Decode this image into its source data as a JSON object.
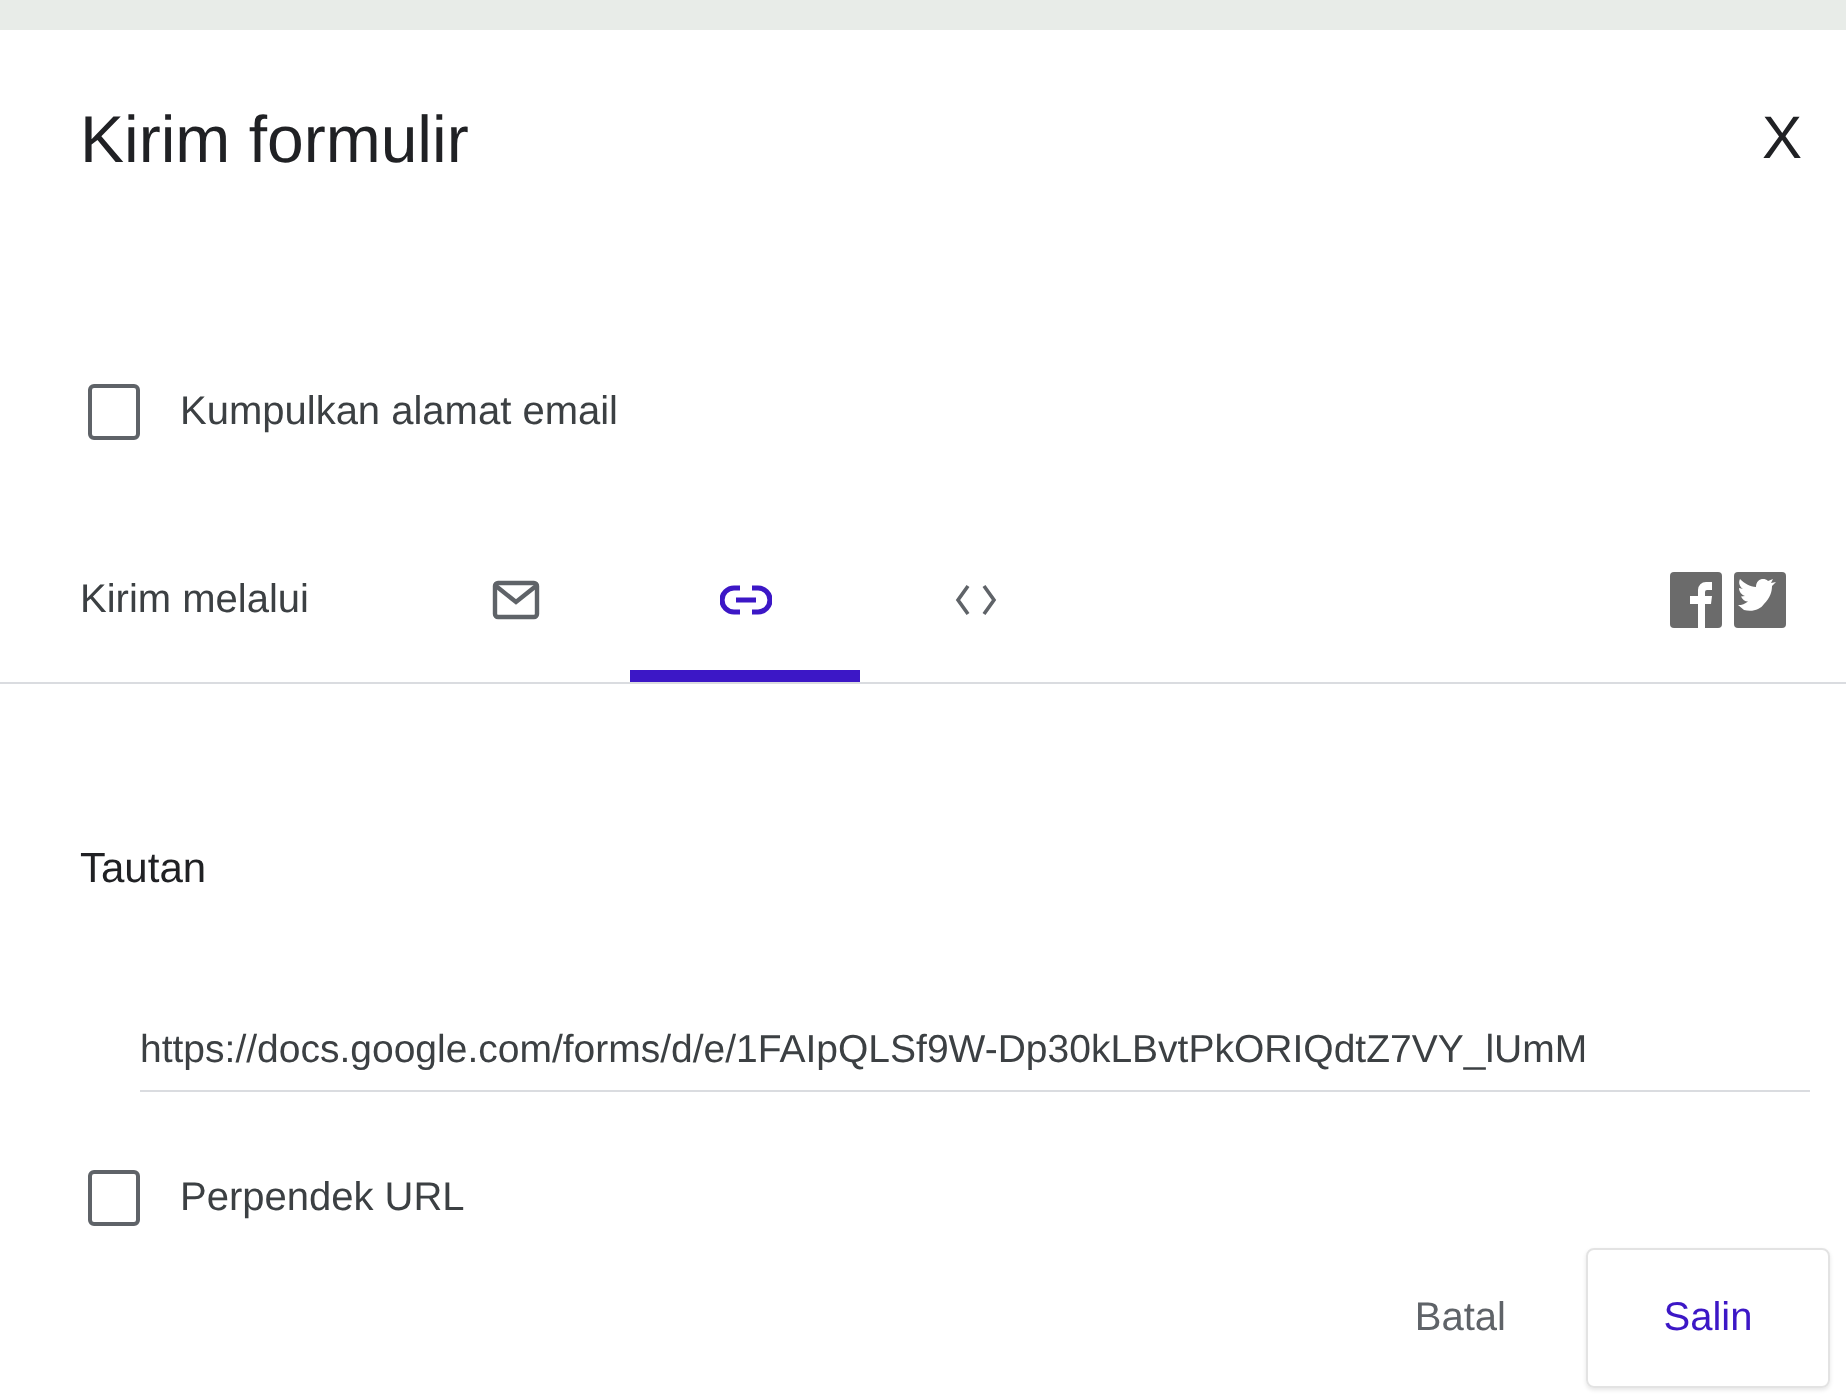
{
  "dialog": {
    "title": "Kirim formulir",
    "close": "X"
  },
  "collect_email": {
    "label": "Kumpulkan alamat email",
    "checked": false
  },
  "send_via": {
    "label": "Kirim melalui",
    "tabs": [
      {
        "kind": "email",
        "selected": false
      },
      {
        "kind": "link",
        "selected": true
      },
      {
        "kind": "embed",
        "selected": false
      }
    ]
  },
  "link": {
    "heading": "Tautan",
    "url": "https://docs.google.com/forms/d/e/1FAIpQLSf9W-Dp30kLBvtPkORIQdtZ7VY_lUmM"
  },
  "shorten_url": {
    "label": "Perpendek URL",
    "checked": false
  },
  "buttons": [
    {
      "kind": "text",
      "label": "Batal"
    },
    {
      "kind": "outlined",
      "label": "Salin"
    }
  ]
}
